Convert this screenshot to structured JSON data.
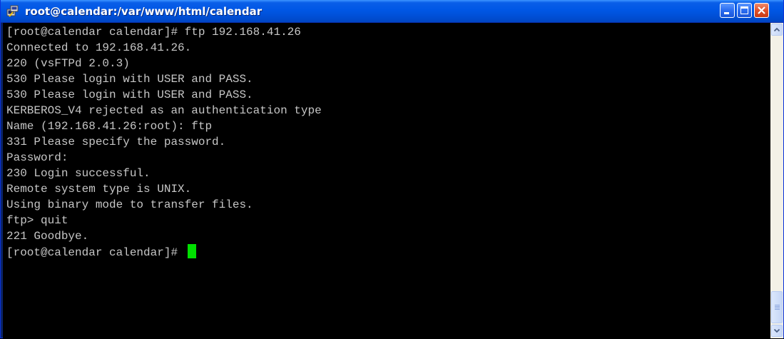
{
  "window": {
    "title": "root@calendar:/var/www/html/calendar",
    "icon": "putty-terminal-icon"
  },
  "terminal": {
    "lines": [
      "[root@calendar calendar]# ftp 192.168.41.26",
      "Connected to 192.168.41.26.",
      "220 (vsFTPd 2.0.3)",
      "530 Please login with USER and PASS.",
      "530 Please login with USER and PASS.",
      "KERBEROS_V4 rejected as an authentication type",
      "Name (192.168.41.26:root): ftp",
      "331 Please specify the password.",
      "Password:",
      "230 Login successful.",
      "Remote system type is UNIX.",
      "Using binary mode to transfer files.",
      "ftp> quit",
      "221 Goodbye."
    ],
    "prompt": "[root@calendar calendar]# ",
    "cursor_color": "#00e000"
  },
  "colors": {
    "titlebar": "#0057e5",
    "terminal_bg": "#000000",
    "terminal_fg": "#c6c6c6"
  }
}
